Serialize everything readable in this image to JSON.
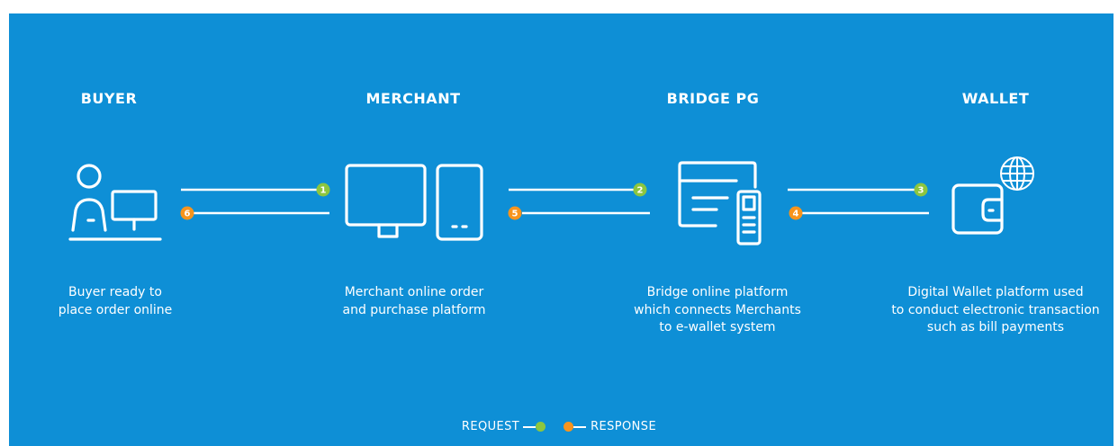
{
  "colors": {
    "background": "#0e8fd6",
    "line": "#ffffff",
    "request": "#8cc63f",
    "response": "#f7941d"
  },
  "columns": [
    {
      "title": "BUYER",
      "description": [
        "Buyer ready to",
        "place order online"
      ],
      "icon": "buyer-at-computer-icon"
    },
    {
      "title": "MERCHANT",
      "description": [
        "Merchant online order",
        "and purchase platform"
      ],
      "icon": "desktop-and-mobile-icon"
    },
    {
      "title": "BRIDGE PG",
      "description": [
        "Bridge online platform",
        "which connects Merchants",
        "to e-wallet system"
      ],
      "icon": "payment-terminal-icon"
    },
    {
      "title": "WALLET",
      "description": [
        "Digital Wallet platform used",
        "to conduct electronic transaction",
        "such as bill payments"
      ],
      "icon": "wallet-globe-icon"
    }
  ],
  "flows": {
    "request_steps": [
      "1",
      "2",
      "3"
    ],
    "response_steps": [
      "6",
      "5",
      "4"
    ]
  },
  "legend": {
    "request": "REQUEST",
    "response": "RESPONSE"
  }
}
